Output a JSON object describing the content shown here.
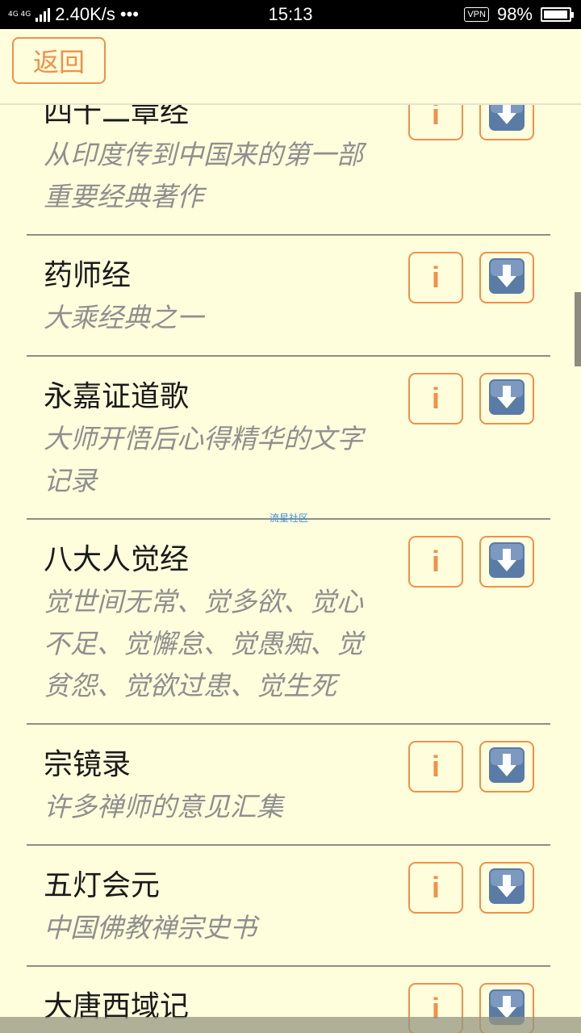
{
  "status_bar": {
    "network_type": "4G 4G",
    "speed": "2.40K/s",
    "dots": "•••",
    "time": "15:13",
    "vpn": "VPN",
    "battery": "98%"
  },
  "header": {
    "back_label": "返回"
  },
  "watermark": "流星社区",
  "info_glyph": "i",
  "colors": {
    "accent": "#F0904A",
    "background": "#FFFEDC",
    "download_icon": "#5A7BA5"
  },
  "items": [
    {
      "title": "四十二章经",
      "desc": "从印度传到中国来的第一部重要经典著作"
    },
    {
      "title": "药师经",
      "desc": "大乘经典之一"
    },
    {
      "title": "永嘉证道歌",
      "desc": "大师开悟后心得精华的文字记录"
    },
    {
      "title": "八大人觉经",
      "desc": "觉世间无常、觉多欲、觉心不足、觉懈怠、觉愚痴、觉贫怨、觉欲过患、觉生死"
    },
    {
      "title": "宗镜录",
      "desc": "许多禅师的意见汇集"
    },
    {
      "title": "五灯会元",
      "desc": "中国佛教禅宗史书"
    },
    {
      "title": "大唐西域记",
      "desc": ""
    }
  ]
}
